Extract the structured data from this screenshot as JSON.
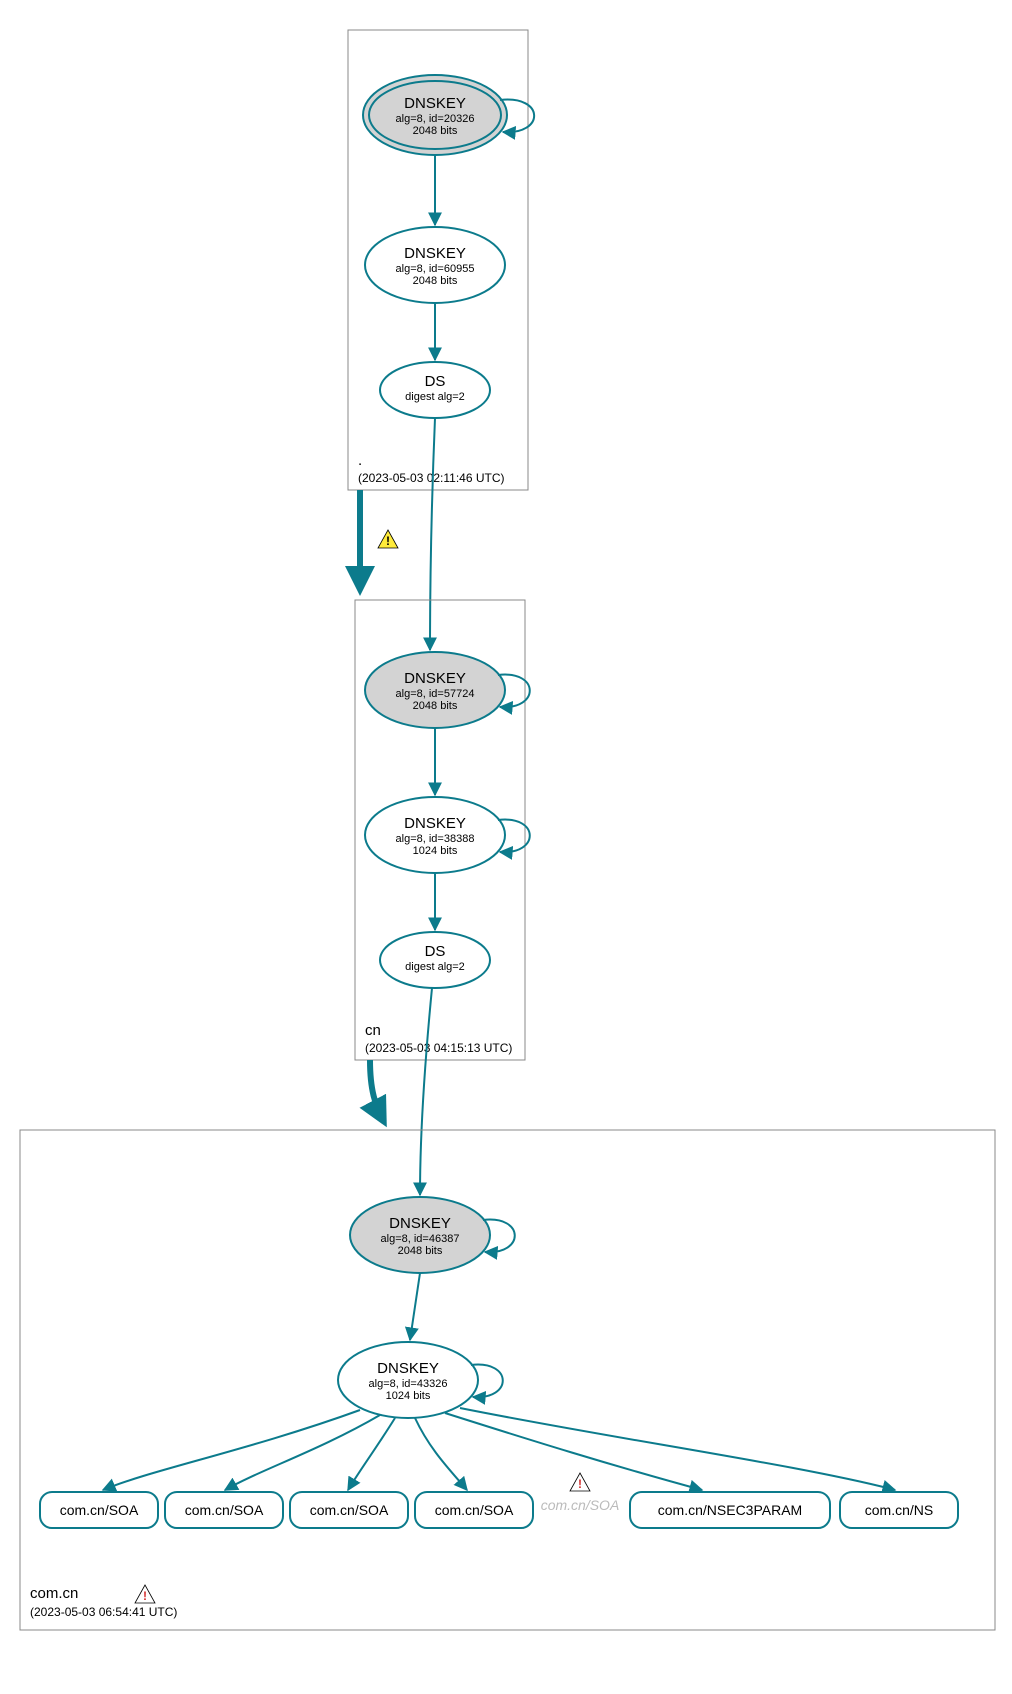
{
  "colors": {
    "accent": "#0c7b8c",
    "grayFill": "#d3d3d3",
    "warnYellow": "#ffeb3b",
    "warnRed": "#d32f2f"
  },
  "zones": {
    "root": {
      "name": ".",
      "timestamp": "(2023-05-03 02:11:46 UTC)"
    },
    "cn": {
      "name": "cn",
      "timestamp": "(2023-05-03 04:15:13 UTC)"
    },
    "comcn": {
      "name": "com.cn",
      "timestamp": "(2023-05-03 06:54:41 UTC)"
    }
  },
  "nodes": {
    "root_ksk": {
      "title": "DNSKEY",
      "line2": "alg=8, id=20326",
      "line3": "2048 bits"
    },
    "root_zsk": {
      "title": "DNSKEY",
      "line2": "alg=8, id=60955",
      "line3": "2048 bits"
    },
    "root_ds": {
      "title": "DS",
      "line2": "digest alg=2"
    },
    "cn_ksk": {
      "title": "DNSKEY",
      "line2": "alg=8, id=57724",
      "line3": "2048 bits"
    },
    "cn_zsk": {
      "title": "DNSKEY",
      "line2": "alg=8, id=38388",
      "line3": "1024 bits"
    },
    "cn_ds": {
      "title": "DS",
      "line2": "digest alg=2"
    },
    "comcn_ksk": {
      "title": "DNSKEY",
      "line2": "alg=8, id=46387",
      "line3": "2048 bits"
    },
    "comcn_zsk": {
      "title": "DNSKEY",
      "line2": "alg=8, id=43326",
      "line3": "1024 bits"
    }
  },
  "leaves": {
    "soa1": {
      "label": "com.cn/SOA"
    },
    "soa2": {
      "label": "com.cn/SOA"
    },
    "soa3": {
      "label": "com.cn/SOA"
    },
    "soa4": {
      "label": "com.cn/SOA"
    },
    "soa5": {
      "label": "com.cn/SOA"
    },
    "nsec3": {
      "label": "com.cn/NSEC3PARAM"
    },
    "ns": {
      "label": "com.cn/NS"
    }
  }
}
